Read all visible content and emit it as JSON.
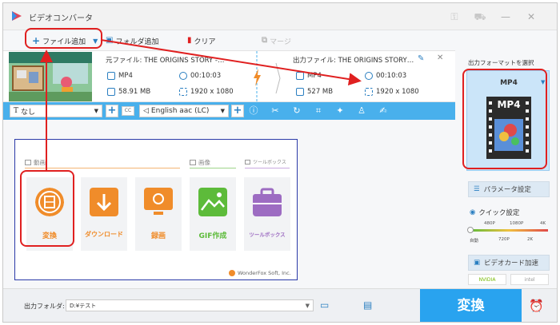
{
  "window": {
    "title": "ビデオコンバータ"
  },
  "toolbar": {
    "add_file": "ファイル追加",
    "add_folder": "フォルダ追加",
    "clear": "クリア",
    "merge": "マージ"
  },
  "file": {
    "source_label": "元ファイル: THE ORIGINS STORY -…",
    "output_label": "出力ファイル: THE ORIGINS STORY…",
    "source_format": "MP4",
    "source_duration": "00:10:03",
    "source_size": "58.91 MB",
    "source_resolution": "1920 x 1080",
    "output_format": "MP4",
    "output_duration": "00:10:03",
    "output_size": "527 MB",
    "output_resolution": "1920 x 1080"
  },
  "controls": {
    "subtitle_value": "なし",
    "audio_value": "English aac (LC)"
  },
  "sections": {
    "video": "動画",
    "image": "画像",
    "tools": "ツールボックス"
  },
  "tiles": [
    {
      "label": "変換",
      "color": "#f08c2a"
    },
    {
      "label": "ダウンロード",
      "color": "#f08c2a"
    },
    {
      "label": "録画",
      "color": "#f08c2a"
    },
    {
      "label": "GIF作成",
      "color": "#5dbb3a"
    },
    {
      "label": "ツールボックス",
      "color": "#9d6cc2"
    }
  ],
  "credit": "WonderFox Soft, Inc.",
  "right": {
    "format_title": "出力フォーマットを選択",
    "format_selected": "MP4",
    "format_icon_text": "MP4",
    "param_button": "パラメータ設定",
    "quick_title": "クイック設定",
    "quality_top": [
      "480P",
      "1080P",
      "4K"
    ],
    "quality_bottom": [
      "自動",
      "720P",
      "2K"
    ],
    "gpu_button": "ビデオカード加速",
    "nvidia": "NVIDIA",
    "intel": "intel"
  },
  "bottom": {
    "output_folder_label": "出力フォルダ:",
    "output_folder_value": "D:¥テスト",
    "convert": "変換"
  }
}
